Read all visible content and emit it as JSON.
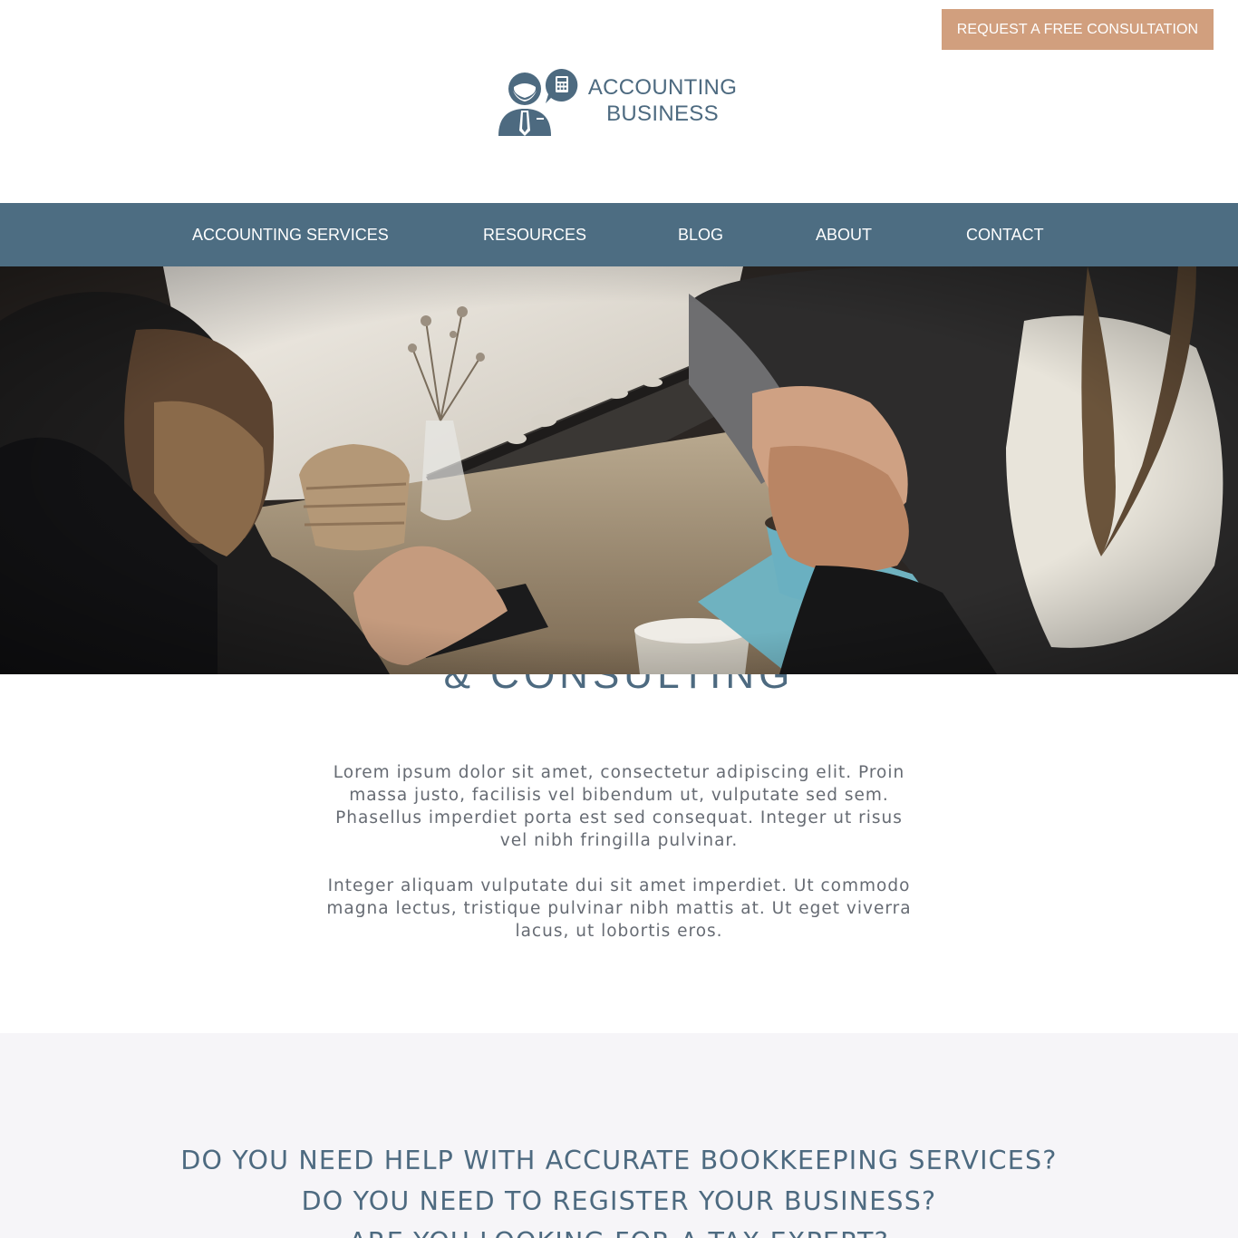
{
  "header": {
    "cta_label": "REQUEST A FREE CONSULTATION",
    "logo": {
      "line1": "ACCOUNTING",
      "line2": "BUSINESS",
      "icon": "accountant-with-calculator-icon"
    }
  },
  "nav": {
    "items": [
      {
        "label": "ACCOUNTING SERVICES"
      },
      {
        "label": "RESOURCES"
      },
      {
        "label": "BLOG"
      },
      {
        "label": "ABOUT"
      },
      {
        "label": "CONTACT"
      }
    ]
  },
  "hero": {
    "image": "handshake-photo"
  },
  "intro": {
    "heading_partial": "& CONSULTING",
    "paragraphs": [
      "Lorem ipsum dolor sit amet, consectetur adipiscing elit. Proin massa justo, facilisis vel bibendum ut, vulputate sed sem. Phasellus imperdiet porta est sed consequat. Integer ut risus vel nibh fringilla pulvinar.",
      "Integer aliquam vulputate dui sit amet imperdiet. Ut commodo magna lectus, tristique pulvinar nibh mattis at. Ut eget viverra lacus, ut lobortis eros."
    ]
  },
  "questions": {
    "lines": [
      "DO YOU NEED HELP WITH ACCURATE BOOKKEEPING SERVICES?",
      "DO YOU NEED TO REGISTER YOUR BUSINESS?",
      "ARE YOU LOOKING FOR A TAX EXPERT?"
    ]
  },
  "colors": {
    "accent": "#d19f7e",
    "primary": "#4d6d82",
    "text": "#666b73",
    "band": "#f6f5f8"
  }
}
